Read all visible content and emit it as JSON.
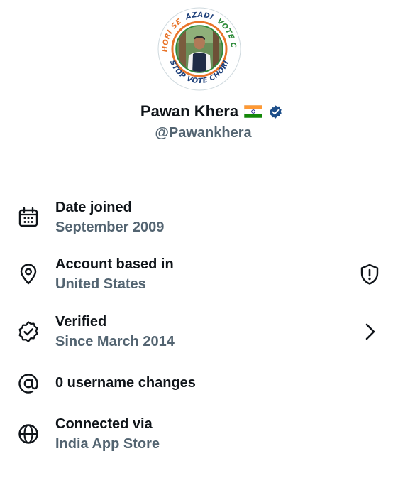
{
  "profile": {
    "display_name": "Pawan Khera",
    "handle": "@Pawankhera",
    "flag_icon": "india-flag-icon",
    "badge_icon": "verified-badge-icon",
    "badge_color": "#1d4e89",
    "avatar_ring": {
      "top_text_left": "VOTE CHORI SE",
      "top_text_center": "AZADI",
      "top_text_right": "VOTE CHORI SE",
      "bottom_text": "STOP VOTE CHORI",
      "colors": [
        "#e8742a",
        "#ffffff",
        "#2e8b3a"
      ],
      "text_color": "#1d3f7a"
    }
  },
  "info_rows": [
    {
      "icon": "calendar-icon",
      "title": "Date joined",
      "value": "September 2009",
      "action_icon": ""
    },
    {
      "icon": "location-pin-icon",
      "title": "Account based in",
      "value": "United States",
      "action_icon": "shield-alert-icon"
    },
    {
      "icon": "verified-check-icon",
      "title": "Verified",
      "value": "Since March 2014",
      "action_icon": "chevron-right-icon"
    },
    {
      "icon": "at-sign-icon",
      "title": "0 username changes",
      "value": "",
      "action_icon": ""
    },
    {
      "icon": "globe-icon",
      "title": "Connected via",
      "value": "India App Store",
      "action_icon": ""
    }
  ],
  "colors": {
    "primary_text": "#0f1419",
    "secondary_text": "#536471",
    "background": "#ffffff"
  }
}
